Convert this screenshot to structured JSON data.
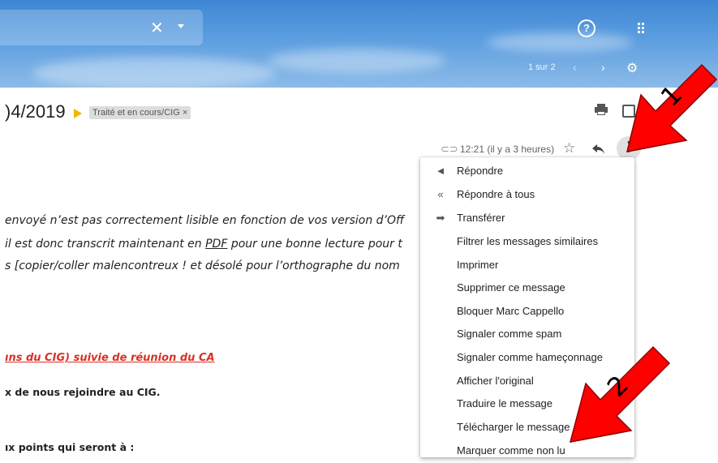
{
  "header": {
    "close_glyph": "✕",
    "help_glyph": "?",
    "pager": "1 sur 2",
    "prev_glyph": "‹",
    "next_glyph": "›",
    "settings_icon": "gear-icon",
    "gear_glyph": "⚙"
  },
  "email": {
    "subject_partial": ")4/2019",
    "label": "Traité et en cours/CIG ×",
    "time": "12:21 (il y a 3 heures)",
    "star_glyph": "☆",
    "reply_glyph": "➦",
    "more_glyph": "⋮",
    "clip_glyph": "⊂⊃"
  },
  "body": {
    "line1": "envoyé n’est pas correctement lisible en fonction de vos version d’Off",
    "line2_a": "il est donc transcrit maintenant en ",
    "line2_pdf": "PDF",
    "line2_b": " pour une bonne lecture pour t",
    "line3": "s [copier/coller malencontreux ! et désolé pour l’orthographe du nom",
    "red_line": "ıns du CIG) suivie de réunion du CA",
    "line5": "x de nous rejoindre au CIG.",
    "line6": "ıx points qui seront à :"
  },
  "menu": {
    "items": [
      {
        "label": "Répondre",
        "icon": "reply-icon",
        "glyph": "◄"
      },
      {
        "label": "Répondre à tous",
        "icon": "reply-all-icon",
        "glyph": "«"
      },
      {
        "label": "Transférer",
        "icon": "forward-icon",
        "glyph": "➡"
      },
      {
        "label": "Filtrer les messages similaires"
      },
      {
        "label": "Imprimer"
      },
      {
        "label": "Supprimer ce message"
      },
      {
        "label": "Bloquer Marc Cappello"
      },
      {
        "label": "Signaler comme spam"
      },
      {
        "label": "Signaler comme hameçonnage"
      },
      {
        "label": "Afficher l'original"
      },
      {
        "label": "Traduire le message"
      },
      {
        "label": "Télécharger le message"
      },
      {
        "label": "Marquer comme non lu"
      }
    ]
  },
  "annotations": {
    "arrow1_number": "1",
    "arrow2_number": "2",
    "arrow_color": "#ff0000"
  }
}
